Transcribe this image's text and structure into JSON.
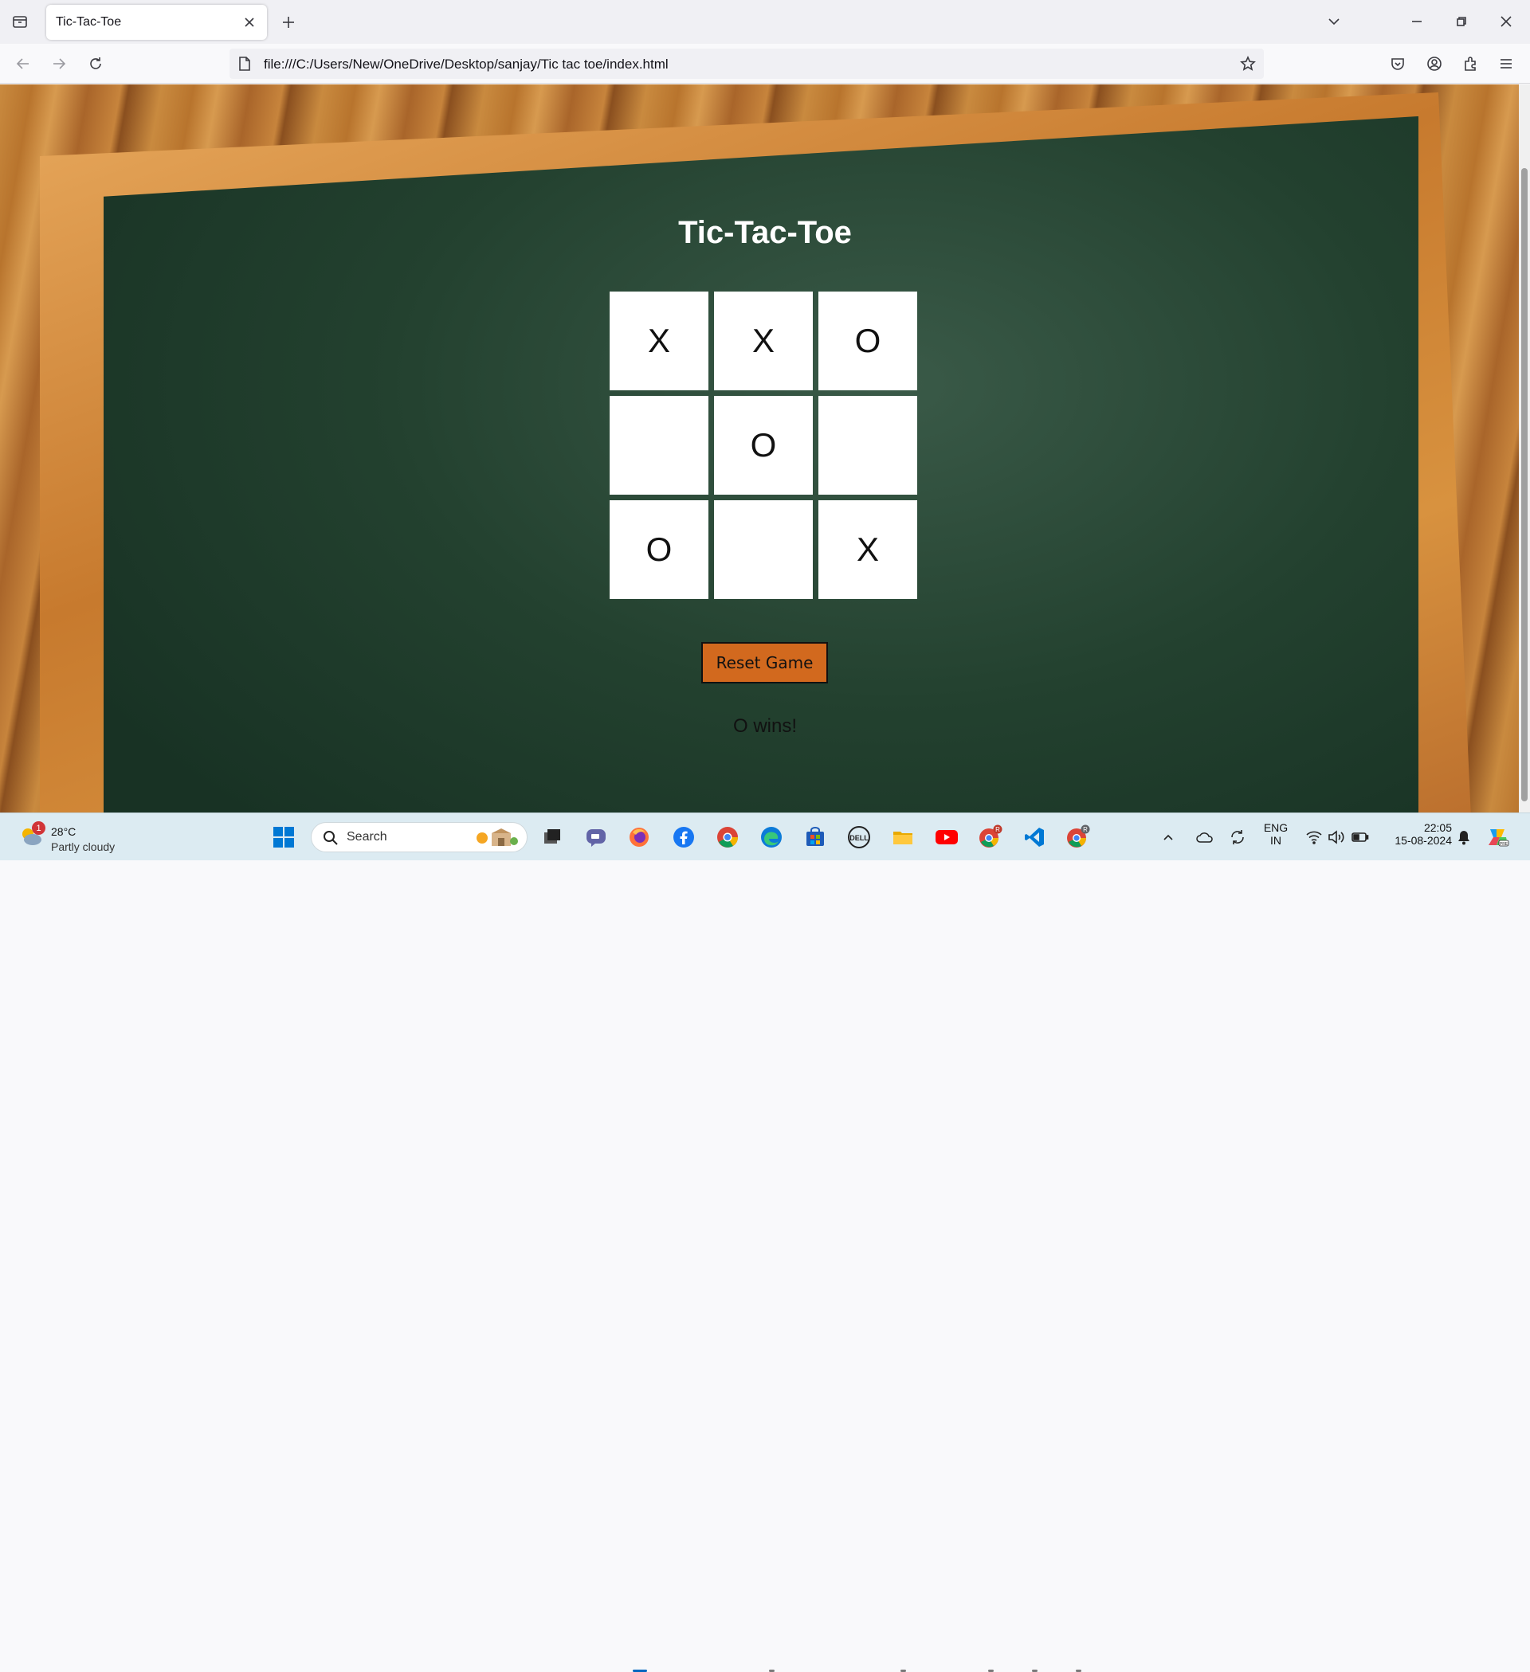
{
  "browser": {
    "tab_title": "Tic-Tac-Toe",
    "url": "file:///C:/Users/New/OneDrive/Desktop/sanjay/Tic tac toe/index.html"
  },
  "game": {
    "title": "Tic-Tac-Toe",
    "cells": [
      "X",
      "X",
      "O",
      "",
      "O",
      "",
      "O",
      "",
      "X"
    ],
    "reset_label": "Reset Game",
    "status": "O wins!",
    "colors": {
      "button": "#d2691e",
      "board": "#23412f",
      "cell": "#ffffff"
    }
  },
  "taskbar": {
    "weather_temp": "28°C",
    "weather_condition": "Partly cloudy",
    "weather_badge": "1",
    "search_label": "Search",
    "lang_top": "ENG",
    "lang_bottom": "IN",
    "time": "22:05",
    "date": "15-08-2024"
  }
}
